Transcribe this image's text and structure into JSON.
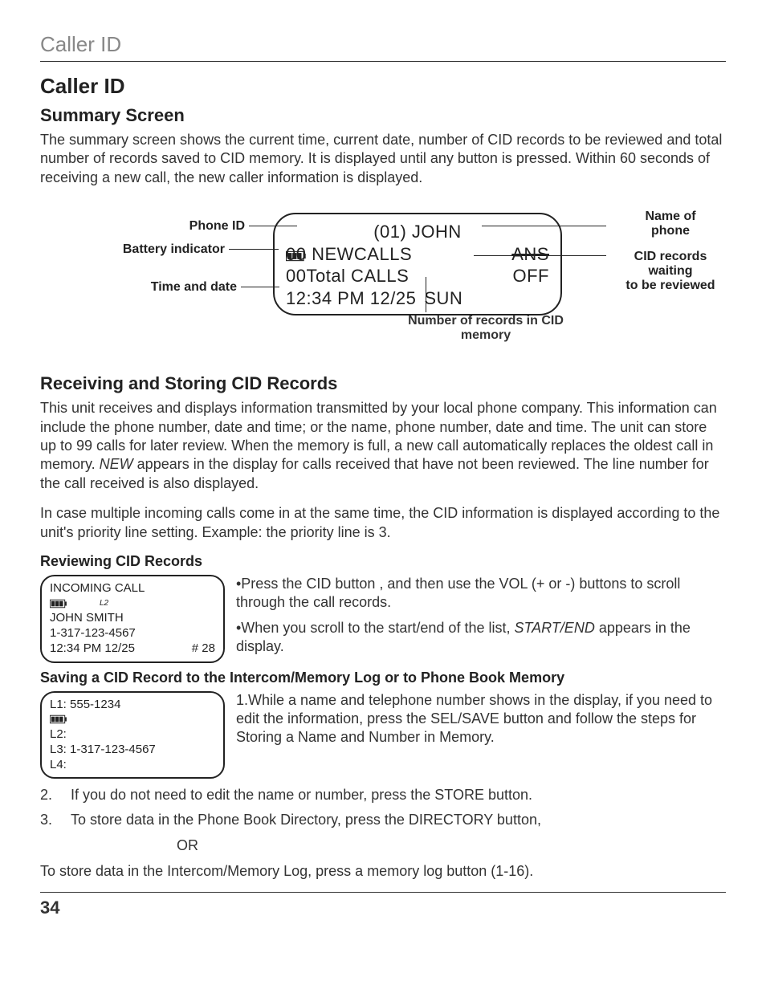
{
  "section": {
    "title": "Caller ID"
  },
  "h1": "Caller ID",
  "summary": {
    "heading": "Summary Screen",
    "para": "The summary screen shows the current time, current date, number of CID records to be reviewed and total number of records saved to CID memory. It is displayed until any button is pressed. Within 60 seconds of receiving a new call, the new caller information is displayed."
  },
  "diagram": {
    "labels_left": {
      "phone_id": "Phone ID",
      "battery": "Battery indicator",
      "time_date": "Time and date"
    },
    "labels_right": {
      "name_of_phone_l1": "Name of",
      "name_of_phone_l2": "phone",
      "cid_records_l1": "CID records",
      "cid_records_l2": "waiting",
      "cid_records_l3": "to be reviewed"
    },
    "screen": {
      "line1": "(01) JOHN",
      "line2_left": "00 NEWCALLS",
      "line2_right": "ANS",
      "line3_left": "00Total CALLS",
      "line3_right": "OFF",
      "line4_left": "12:34 PM 12/25",
      "line4_right": "SUN"
    },
    "caption_below_l1": "Number of records in CID",
    "caption_below_l2": "memory"
  },
  "receiving": {
    "heading": "Receiving and Storing CID Records",
    "para1": "This unit receives and displays information transmitted by your local phone company. This information can include the phone number, date and time; or the name, phone number, date and time. The unit can store up to 99 calls for later review. When the memory is full, a new call automatically replaces the oldest call in memory. ",
    "para1_italic": "NEW",
    "para1_after": " appears in the display for calls received that have not been reviewed. The line number for the call received is also displayed.",
    "para2": "In case multiple incoming calls come in at the same time, the CID information is displayed according to the unit's priority line setting. Example: the priority line is 3."
  },
  "reviewing": {
    "heading": "Reviewing CID Records",
    "lcd": {
      "l1": "INCOMING CALL",
      "l2_sub": "L2",
      "l3": "JOHN SMITH",
      "l4": "1-317-123-4567",
      "l5_left": "12:34 PM 12/25",
      "l5_right": "# 28"
    },
    "bullet1": "•Press the CID button , and then use the VOL (+ or -) buttons to scroll through the call records.",
    "bullet2_pre": "•When you scroll to the start/end of the list, ",
    "bullet2_italic": "START/END",
    "bullet2_post": " appears in the display."
  },
  "saving": {
    "heading": "Saving a CID Record to the Intercom/Memory Log or to Phone Book Memory",
    "lcd": {
      "l1": "L1: 555-1234",
      "l2": "L2:",
      "l3": "L3: 1-317-123-4567",
      "l4": "L4:"
    },
    "step1": "1.While a name and telephone number shows in the display, if you need to edit the information, press the SEL/SAVE button and follow the steps for Storing a Name and Number in Memory.",
    "step2_num": "2.",
    "step2": "If you do not need to edit the name or number, press the STORE button.",
    "step3_num": "3.",
    "step3": "To store data in the Phone Book Directory, press the DIRECTORY button,",
    "or": "OR",
    "final": "To store data in the Intercom/Memory Log, press a memory log button (1-16)."
  },
  "page_number": "34"
}
